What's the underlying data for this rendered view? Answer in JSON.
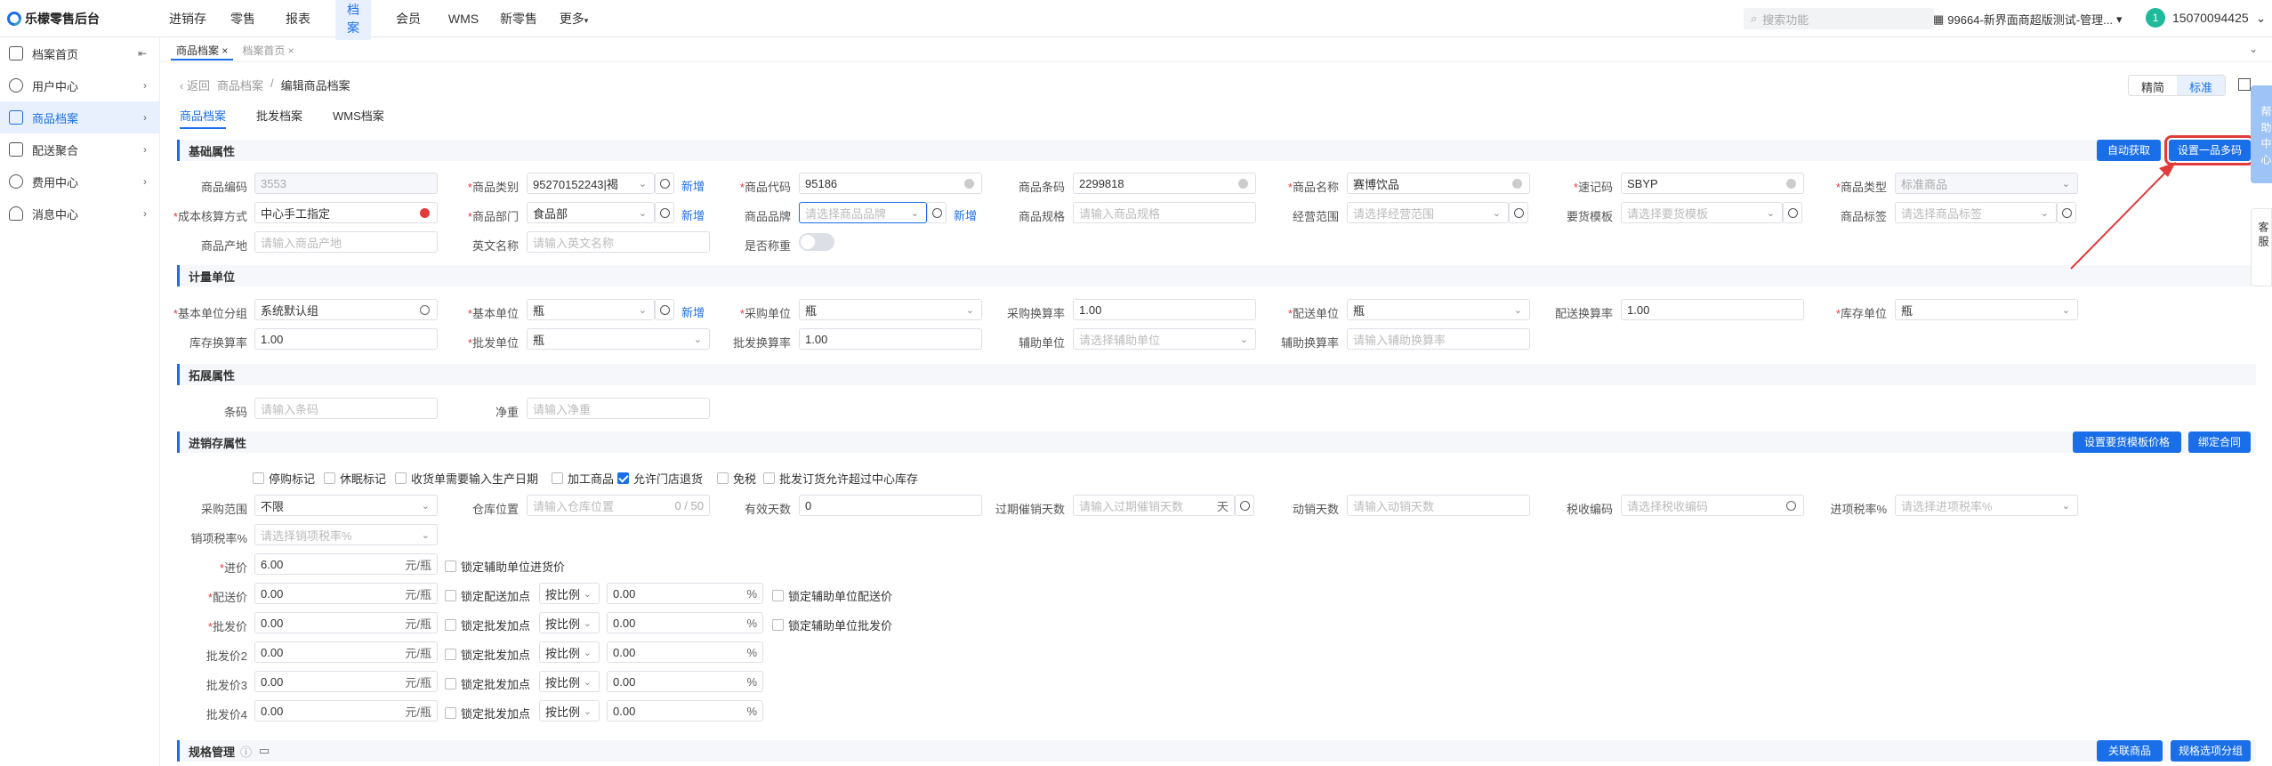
{
  "app": {
    "title": "乐檬零售后台"
  },
  "topnav": {
    "items": [
      "进销存",
      "零售",
      "报表",
      "档案",
      "会员",
      "WMS",
      "新零售",
      "更多"
    ],
    "active": "档案",
    "search_placeholder": "搜索功能",
    "store": "99664-新界面商超版测试-管理...",
    "user_initial": "1",
    "phone": "15070094425"
  },
  "sidebar": {
    "items": [
      "档案首页",
      "用户中心",
      "商品档案",
      "配送聚合",
      "费用中心",
      "消息中心"
    ],
    "active": "商品档案"
  },
  "tabs": [
    {
      "label": "商品档案 ×"
    },
    {
      "label": "档案首页 ×"
    }
  ],
  "breadcrumb": {
    "back": "返回",
    "parent": "商品档案",
    "sep": "/",
    "current": "编辑商品档案"
  },
  "view": {
    "precise": "精简",
    "standard": "标准"
  },
  "subtabs": [
    "商品档案",
    "批发档案",
    "WMS档案"
  ],
  "sections": {
    "basic": "基础属性",
    "unit": "计量单位",
    "ext": "拓展属性",
    "inv": "进销存属性",
    "spec": "规格管理"
  },
  "buttons": {
    "auto_fetch": "自动获取",
    "multi_code": "设置一品多码",
    "set_price": "设置要货模板价格",
    "bind_contract": "绑定合同",
    "link_goods": "关联商品",
    "spec_group": "规格选项分组"
  },
  "new_label": "新增",
  "basic": {
    "code_label": "商品编码",
    "code_value": "3553",
    "category_label": "商品类别",
    "category_value": "95270152243|褐",
    "prod_code_label": "商品代码",
    "prod_code_value": "95186",
    "barcode_label": "商品条码",
    "barcode_value": "2299818",
    "name_label": "商品名称",
    "name_value": "赛博饮品",
    "shortcode_label": "速记码",
    "shortcode_value": "SBYP",
    "type_label": "商品类型",
    "type_value": "标准商品",
    "cost_label": "成本核算方式",
    "cost_value": "中心手工指定",
    "dept_label": "商品部门",
    "dept_value": "食品部",
    "brand_label": "商品品牌",
    "brand_ph": "请选择商品品牌",
    "spec_label": "商品规格",
    "spec_ph": "请输入商品规格",
    "scope_label": "经营范围",
    "scope_ph": "请选择经营范围",
    "tmpl_label": "要货模板",
    "tmpl_ph": "请选择要货模板",
    "tag_label": "商品标签",
    "tag_ph": "请选择商品标签",
    "origin_label": "商品产地",
    "origin_ph": "请输入商品产地",
    "en_label": "英文名称",
    "en_ph": "请输入英文名称",
    "weigh_label": "是否称重"
  },
  "unit": {
    "group_label": "基本单位分组",
    "group_value": "系统默认组",
    "base_label": "基本单位",
    "base_value": "瓶",
    "purchase_label": "采购单位",
    "purchase_value": "瓶",
    "purchase_rate_label": "采购换算率",
    "purchase_rate_value": "1.00",
    "delivery_label": "配送单位",
    "delivery_value": "瓶",
    "delivery_rate_label": "配送换算率",
    "delivery_rate_value": "1.00",
    "stock_label": "库存单位",
    "stock_value": "瓶",
    "stock_rate_label": "库存换算率",
    "stock_rate_value": "1.00",
    "whole_label": "批发单位",
    "whole_value": "瓶",
    "whole_rate_label": "批发换算率",
    "whole_rate_value": "1.00",
    "aux_label": "辅助单位",
    "aux_ph": "请选择辅助单位",
    "aux_rate_label": "辅助换算率",
    "aux_rate_ph": "请输入辅助换算率"
  },
  "ext": {
    "barcode_label": "条码",
    "barcode_ph": "请输入条码",
    "weight_label": "净重",
    "weight_ph": "请输入净重"
  },
  "inv": {
    "checks": [
      {
        "label": "停购标记",
        "on": false
      },
      {
        "label": "休眠标记",
        "on": false
      },
      {
        "label": "收货单需要输入生产日期",
        "on": false
      },
      {
        "label": "加工商品",
        "on": false
      },
      {
        "label": "允许门店退货",
        "on": true
      },
      {
        "label": "免税",
        "on": false
      },
      {
        "label": "批发订货允许超过中心库存",
        "on": false
      }
    ],
    "scope_label": "采购范围",
    "scope_value": "不限",
    "loc_label": "仓库位置",
    "loc_ph": "请输入仓库位置",
    "loc_count": "0 / 50",
    "valid_label": "有效天数",
    "valid_value": "0",
    "expire_label": "过期催销天数",
    "expire_ph": "请输入过期催销天数",
    "day": "天",
    "move_label": "动销天数",
    "move_ph": "请输入动销天数",
    "tax_label": "税收编码",
    "tax_ph": "请选择税收编码",
    "intax_label": "进项税率%",
    "intax_ph": "请选择进项税率%",
    "outtax_label": "销项税率%",
    "outtax_ph": "请选择销项税率%",
    "unit_text": "元/瓶",
    "pct": "%",
    "ratio": "按比例",
    "prices": [
      {
        "label": "进价",
        "req": true,
        "value": "6.00",
        "lock": "锁定辅助单位进货价",
        "markup": false,
        "aux": ""
      },
      {
        "label": "配送价",
        "req": true,
        "value": "0.00",
        "lock": "锁定配送加点",
        "markup": true,
        "pct_value": "0.00",
        "aux": "锁定辅助单位配送价"
      },
      {
        "label": "批发价",
        "req": true,
        "value": "0.00",
        "lock": "锁定批发加点",
        "markup": true,
        "pct_value": "0.00",
        "aux": "锁定辅助单位批发价"
      },
      {
        "label": "批发价2",
        "req": false,
        "value": "0.00",
        "lock": "锁定批发加点",
        "markup": true,
        "pct_value": "0.00",
        "aux": ""
      },
      {
        "label": "批发价3",
        "req": false,
        "value": "0.00",
        "lock": "锁定批发加点",
        "markup": true,
        "pct_value": "0.00",
        "aux": ""
      },
      {
        "label": "批发价4",
        "req": false,
        "value": "0.00",
        "lock": "锁定批发加点",
        "markup": true,
        "pct_value": "0.00",
        "aux": ""
      }
    ]
  },
  "float": {
    "help": "帮助中心",
    "service": "客服"
  }
}
